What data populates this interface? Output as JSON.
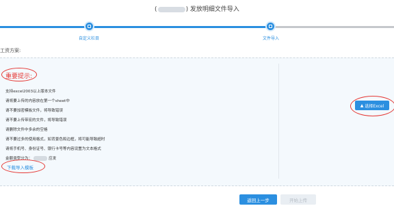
{
  "header": {
    "title_prefix": "(",
    "title_suffix": ") 发放明细文件导入"
  },
  "steps": [
    {
      "label": "自定义栏目"
    },
    {
      "label": "文件导入"
    }
  ],
  "section": {
    "plan_label": "工资方案:"
  },
  "tips": {
    "title": "重要提示:",
    "items": [
      "支持excel2003以上版本文件",
      "请将要上传的内容放在第一个sheet中",
      "请不要加密模板文件，将导致错误",
      "请不要上传带宏的文件，将导致错误",
      "请删除文件中多余的空格",
      "请不要过多的使用格式，如背景色和边框，将可能导致超时",
      "请将手机号、身份证号、银行卡号等内容设置为文本格式"
    ],
    "amount_prefix": "金额类型分为：",
    "amount_suffix": "应发"
  },
  "download_link": "下载导入模板",
  "select_button": "选择Excel",
  "footer": {
    "back_button": "返回上一步",
    "start_button": "开始上传"
  },
  "colors": {
    "accent": "#2b8fe0",
    "annotation": "#e53935"
  }
}
